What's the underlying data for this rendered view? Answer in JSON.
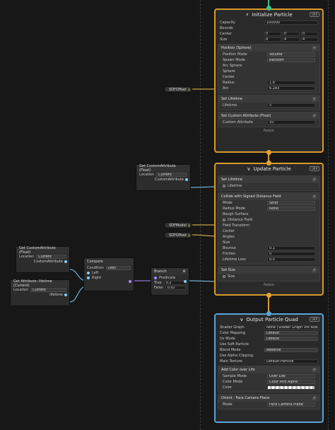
{
  "colors": {
    "orange_context": "#d89a2c",
    "green_output": "#3bc48c",
    "blue_output": "#58a6d8",
    "float_port": "#80d0ff",
    "bool_port": "#a88bff",
    "position_port": "#f29b6a",
    "background": "#171717"
  },
  "initialize": {
    "title": "Initialize Particle",
    "icon": "lightning-icon",
    "capacity_label": "Capacity",
    "capacity_value": "100000",
    "bounds_label": "Bounds",
    "center_label": "Center",
    "center": [
      "0",
      "0",
      "0"
    ],
    "size_label": "Size",
    "size": [
      "4",
      "4",
      "4"
    ],
    "position_block": {
      "title": "Position (Sphere)",
      "mode_label": "Position Mode",
      "mode_value": "Volume",
      "spawn_label": "Spawn Mode",
      "spawn_value": "Random",
      "arc_label": "Arc Sphere",
      "sphere_label": "Sphere",
      "center_label": "Center",
      "radius_label": "Radius",
      "radius_value": "1.8",
      "arc_value_label": "Arc",
      "arc_value": "6.283"
    },
    "lifetime_block": {
      "title": "Set Lifetime",
      "label": "Lifetime",
      "value": "5"
    },
    "custom_block": {
      "title": "Set Custom Attribute (Float)",
      "label": "Custom Attribute",
      "value": "10"
    },
    "footer": "Particle"
  },
  "update": {
    "title": "Update Particle",
    "icon": "chevron-down-icon",
    "lifetime_block": {
      "title": "Set Lifetime",
      "label": "Lifetime"
    },
    "collide_block": {
      "title": "Collide with Signed Distance Field",
      "mode_label": "Mode",
      "mode_value": "Solid",
      "radius_mode_label": "Radius Mode",
      "radius_mode_value": "None",
      "rough_label": "Rough Surface",
      "distance_label": "Distance Field",
      "transform_label": "Field Transform",
      "center_label": "Center",
      "angles_label": "Angles",
      "size_label": "Size",
      "bounce_label": "Bounce",
      "bounce_value": "0.1",
      "friction_label": "Friction",
      "friction_value": "0",
      "lifetime_loss_label": "Lifetime Loss",
      "lifetime_loss_value": "0.5"
    },
    "size_block": {
      "title": "Set Size",
      "label": "Size"
    },
    "footer": "Particle"
  },
  "output": {
    "title": "Output Particle Quad",
    "tag": "URP",
    "rows": [
      {
        "label": "Shader Graph",
        "value": "None (Shader Graph Vfx Asset)"
      },
      {
        "label": "Color Mapping",
        "value": "Default"
      },
      {
        "label": "Uv Mode",
        "value": "Default"
      },
      {
        "label": "Use Soft Particle",
        "value": ""
      },
      {
        "label": "Blend Mode",
        "value": "Additive"
      },
      {
        "label": "Use Alpha Clipping",
        "value": ""
      },
      {
        "label": "Main Texture",
        "value": "Default-Particle"
      }
    ],
    "color_block": {
      "title": "Add Color over Life",
      "sample_label": "Sample Mode",
      "sample_value": "Over Life",
      "mode_label": "Color Mode",
      "mode_value": "Color And Alpha",
      "color_label": "Color"
    },
    "orient_block": {
      "title": "Orient : Face Camera Plane",
      "mode_label": "Mode",
      "mode_value": "Face Camera Plane"
    }
  },
  "tags": {
    "init": "URP",
    "update": "URP"
  },
  "props": {
    "sdf_init": "SDFOffset",
    "sdf_model": "SDFModel",
    "sdf_update": "SDFOffset"
  },
  "get_custom_top": {
    "title": "Get CustomAttribute (Float)",
    "location_label": "Location",
    "location_value": "Current",
    "output": "CustomAttribute"
  },
  "get_custom_left": {
    "title": "Get CustomAttribute (Float)",
    "location_label": "Location",
    "location_value": "Current",
    "output": "CustomAttribute"
  },
  "get_lifetime": {
    "title": "Get Attribute: lifetime (Current)",
    "location_label": "Location",
    "location_value": "Current",
    "output": "lifetime"
  },
  "compare": {
    "title": "Compare",
    "condition_label": "Condition",
    "condition_value": "Less",
    "left_label": "Left",
    "right_label": "Right"
  },
  "branch": {
    "title": "Branch",
    "predicate_label": "Predicate",
    "true_label": "True",
    "true_value": "0.2",
    "false_label": "False",
    "false_value": "0.02"
  }
}
